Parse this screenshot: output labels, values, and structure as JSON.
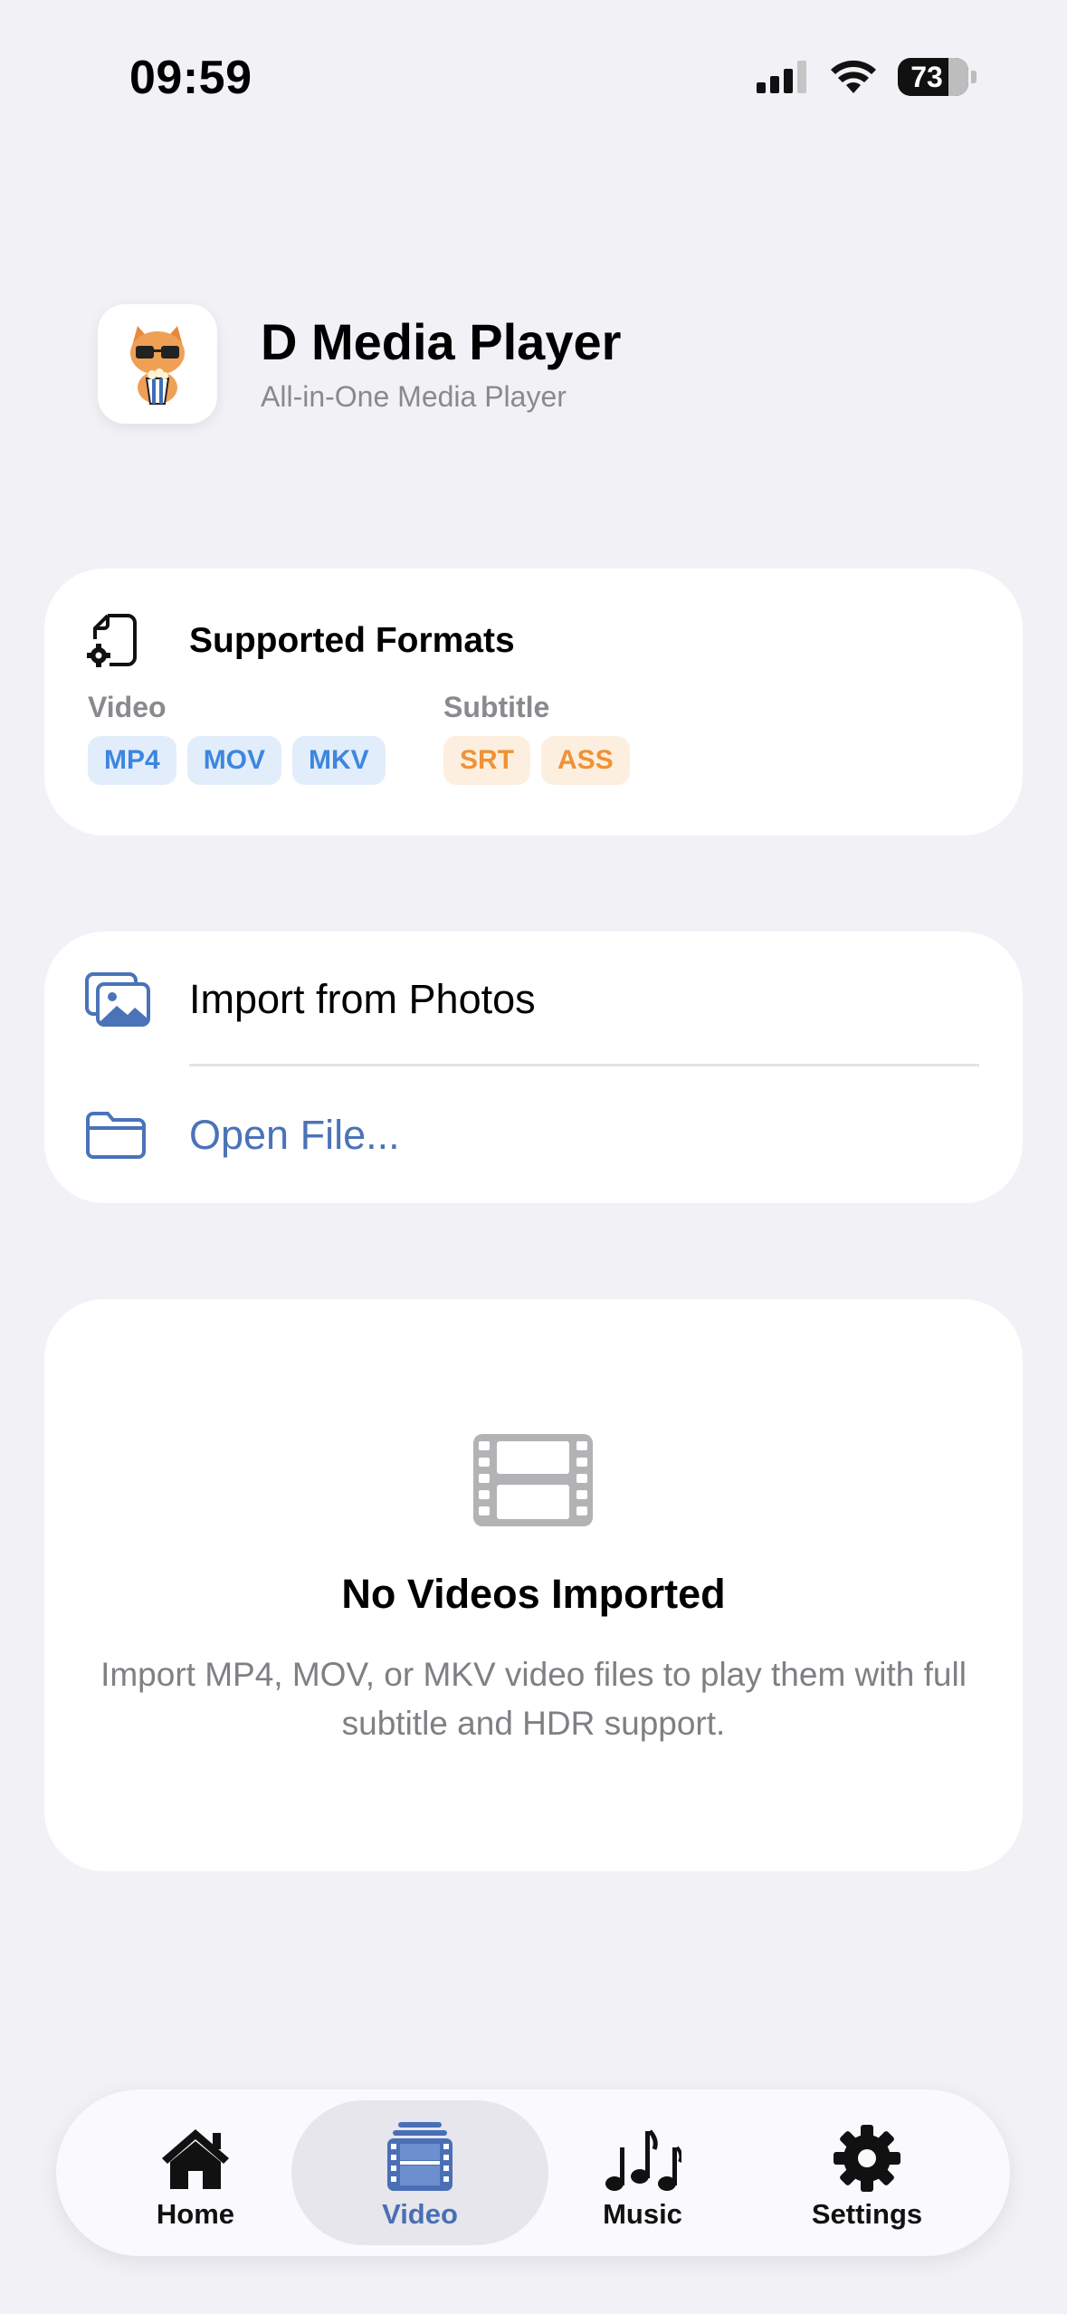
{
  "status_bar": {
    "time": "09:59",
    "battery": "73"
  },
  "header": {
    "title": "D Media Player",
    "subtitle": "All-in-One Media Player"
  },
  "formats": {
    "title": "Supported Formats",
    "video_label": "Video",
    "video_formats": [
      "MP4",
      "MOV",
      "MKV"
    ],
    "subtitle_label": "Subtitle",
    "subtitle_formats": [
      "SRT",
      "ASS"
    ]
  },
  "actions": {
    "import_photos": "Import from Photos",
    "open_file": "Open File..."
  },
  "empty_state": {
    "title": "No Videos Imported",
    "description": "Import MP4, MOV, or MKV video files to play them with full subtitle and HDR support."
  },
  "tabs": [
    {
      "label": "Home",
      "icon": "house-icon"
    },
    {
      "label": "Video",
      "icon": "film-icon"
    },
    {
      "label": "Music",
      "icon": "music-notes-icon"
    },
    {
      "label": "Settings",
      "icon": "gear-icon"
    }
  ],
  "active_tab": "Video",
  "colors": {
    "accent": "#4a6fb5",
    "link": "#4a73b8",
    "video_chip": "#3d86e0",
    "subtitle_chip": "#ef9236"
  }
}
